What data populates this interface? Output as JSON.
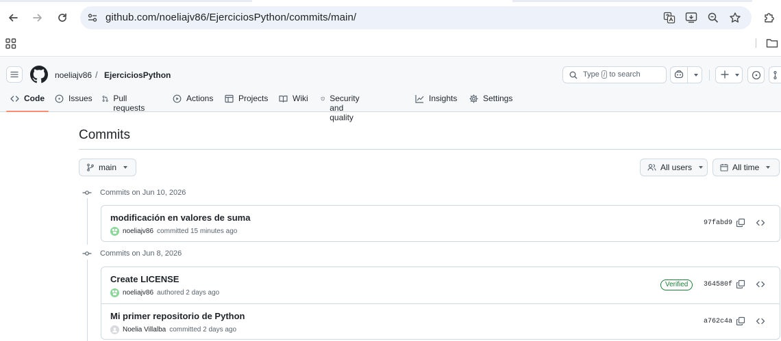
{
  "browser": {
    "url": "github.com/noeliajv86/EjerciciosPython/commits/main/"
  },
  "header": {
    "owner": "noeliajv86",
    "separator": "/",
    "repo": "EjerciciosPython",
    "search_prefix": "Type",
    "search_key": "/",
    "search_suffix": "to search"
  },
  "tabs": [
    {
      "label": "Code",
      "icon": "code-icon",
      "active": true
    },
    {
      "label": "Issues",
      "icon": "issue-icon"
    },
    {
      "label": "Pull requests",
      "icon": "pull-request-icon"
    },
    {
      "label": "Actions",
      "icon": "play-icon"
    },
    {
      "label": "Projects",
      "icon": "table-icon"
    },
    {
      "label": "Wiki",
      "icon": "book-icon"
    },
    {
      "label": "Security and quality",
      "icon": "shield-icon"
    },
    {
      "label": "Insights",
      "icon": "graph-icon"
    },
    {
      "label": "Settings",
      "icon": "gear-icon"
    }
  ],
  "page": {
    "title": "Commits",
    "branch": "main",
    "users_filter": "All users",
    "time_filter": "All time"
  },
  "groups": [
    {
      "label": "Commits on Jun 10, 2026",
      "commits": [
        {
          "message": "modificación en valores de suma",
          "author": "noeliajv86",
          "action": "committed 15 minutes ago",
          "sha": "97fabd9",
          "verified": false,
          "avatar": "green"
        }
      ]
    },
    {
      "label": "Commits on Jun 8, 2026",
      "commits": [
        {
          "message": "Create LICENSE",
          "author": "noeliajv86",
          "action": "authored 2 days ago",
          "sha": "364580f",
          "verified": true,
          "verified_label": "Verified",
          "avatar": "green"
        },
        {
          "message": "Mi primer repositorio de Python",
          "author": "Noelia Villalba",
          "action": "committed 2 days ago",
          "sha": "a762c4a",
          "verified": false,
          "avatar": "grey"
        }
      ]
    }
  ],
  "colors": {
    "active_tab_underline": "#fd8c73",
    "verified": "#1a7f37",
    "omnibox": "#edf2fa",
    "header_bg": "#f6f8fa"
  }
}
